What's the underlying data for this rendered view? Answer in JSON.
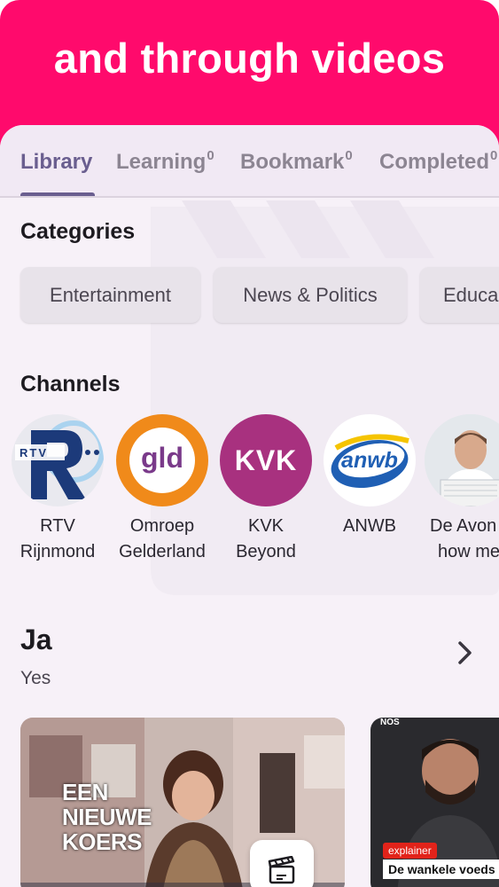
{
  "banner": {
    "title": "and through videos",
    "color": "#ff0a6c"
  },
  "tabs": [
    {
      "label": "Library",
      "count": "",
      "active": true
    },
    {
      "label": "Learning",
      "count": "0",
      "active": false
    },
    {
      "label": "Bookmark",
      "count": "0",
      "active": false
    },
    {
      "label": "Completed",
      "count": "0",
      "active": false
    }
  ],
  "categories": {
    "heading": "Categories",
    "items": [
      "Entertainment",
      "News & Politics",
      "Educa"
    ]
  },
  "channels": {
    "heading": "Channels",
    "items": [
      {
        "line1": "RTV",
        "line2": "Rijnmond",
        "logo_text": "RTV"
      },
      {
        "line1": "Omroep",
        "line2": "Gelderland",
        "logo_text": "gld"
      },
      {
        "line1": "KVK",
        "line2": "Beyond",
        "logo_text": "KVK"
      },
      {
        "line1": "ANWB",
        "line2": "",
        "logo_text": "anwb"
      },
      {
        "line1": "De Avon",
        "line2": "how me",
        "logo_text": ""
      }
    ]
  },
  "video_row": {
    "title": "Ja",
    "subtitle": "Yes",
    "cards": [
      {
        "overlay_lines": [
          "EEN",
          "NIEUWE",
          "KOERS"
        ]
      },
      {
        "brand": "NOS",
        "tag": "explainer",
        "caption": "De wankele voeds"
      }
    ]
  }
}
